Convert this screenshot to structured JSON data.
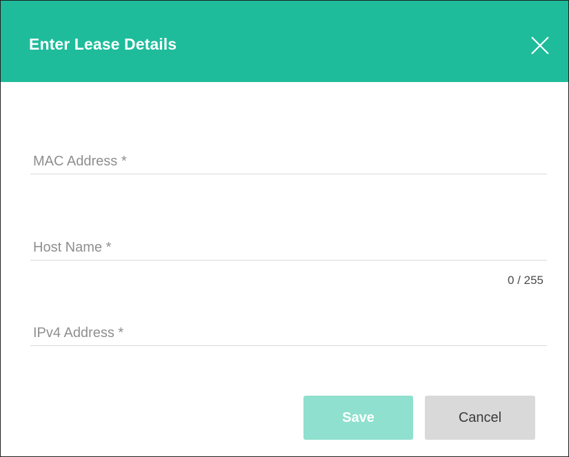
{
  "dialog": {
    "title": "Enter Lease Details",
    "close_icon": "close-icon"
  },
  "fields": {
    "mac": {
      "label": "MAC Address *",
      "value": ""
    },
    "host": {
      "label": "Host Name *",
      "value": "",
      "counter": "0 / 255"
    },
    "ipv4": {
      "label": "IPv4 Address *",
      "value": ""
    }
  },
  "actions": {
    "save_label": "Save",
    "cancel_label": "Cancel"
  },
  "colors": {
    "header_bg": "#1ebc9b",
    "save_bg": "#8fe0ce",
    "cancel_bg": "#d9d9d9"
  }
}
